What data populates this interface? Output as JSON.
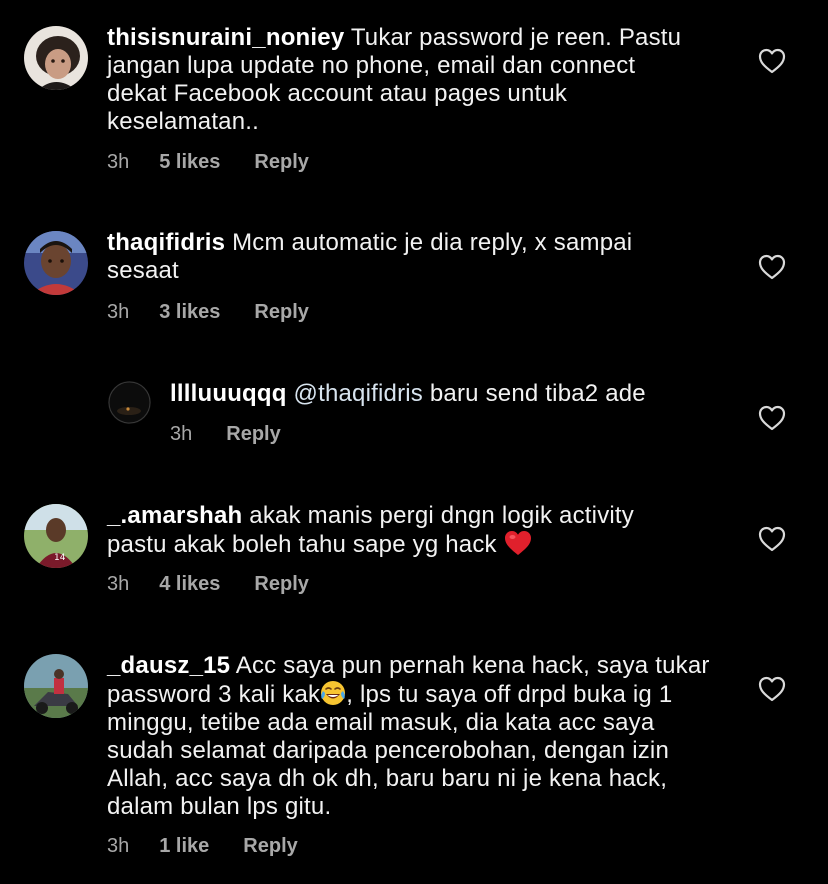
{
  "accent": {
    "heart_red": "#e0202c",
    "meta_gray": "#a8a8a8",
    "background": "#000000"
  },
  "comments": [
    {
      "username": "thisisnuraini_noniey",
      "lines": [
        "Tukar password je reen. Pastu",
        "jangan lupa update no phone, email dan connect",
        "dekat Facebook account atau pages untuk",
        "keselamatan.."
      ],
      "time": "3h",
      "likes": "5 likes",
      "reply": "Reply",
      "like_icon": "heart-outline-icon"
    },
    {
      "username": "thaqifidris",
      "lines": [
        "Mcm automatic je dia reply, x sampai",
        "sesaat"
      ],
      "time": "3h",
      "likes": "3 likes",
      "reply": "Reply",
      "like_icon": "heart-outline-icon"
    },
    {
      "username": "lllluuuqqq",
      "mention": "@thaqifidris",
      "lines": [
        "baru send tiba2 ade"
      ],
      "time": "3h",
      "reply": "Reply",
      "like_icon": "heart-outline-icon"
    },
    {
      "username": "_.amarshah",
      "lines": [
        "akak manis pergi dngn logik activity",
        "pastu akak boleh tahu sape yg hack"
      ],
      "emoji": "red-heart-emoji",
      "time": "3h",
      "likes": "4 likes",
      "reply": "Reply",
      "like_icon": "heart-outline-icon"
    },
    {
      "username": "_dausz_15",
      "lines": [
        "Acc saya pun pernah kena hack, saya tukar",
        "password 3 kali kak",
        ", lps tu saya off drpd buka ig 1",
        "minggu, tetibe ada email masuk, dia kata acc saya",
        "sudah selamat daripada pencerobohan, dengan izin",
        "Allah, acc saya dh ok dh, baru baru ni je kena hack,",
        "dalam bulan lps gitu."
      ],
      "emoji": "tears-of-joy-emoji",
      "time": "3h",
      "likes": "1 like",
      "reply": "Reply",
      "like_icon": "heart-outline-icon"
    }
  ]
}
